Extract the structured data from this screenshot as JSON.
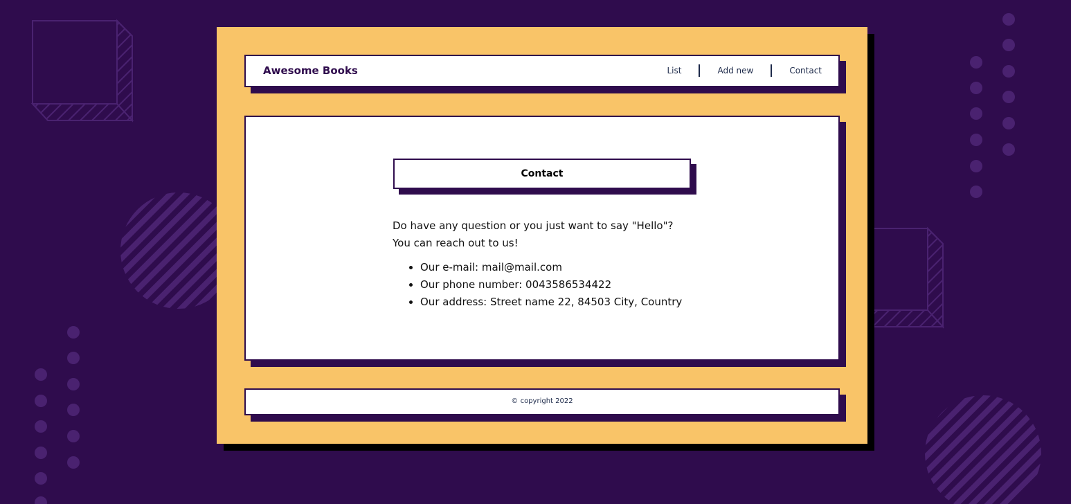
{
  "brand": "Awesome Books",
  "nav": {
    "list": "List",
    "add_new": "Add new",
    "contact": "Contact"
  },
  "main": {
    "title": "Contact",
    "intro_line1": "Do have any question or you just want to say \"Hello\"?",
    "intro_line2": "You can reach out to us!",
    "items": [
      "Our e-mail: mail@mail.com",
      "Our phone number: 0043586534422",
      "Our address: Street name 22, 84503 City, Country"
    ]
  },
  "footer": {
    "copyright": "© copyright 2022"
  },
  "colors": {
    "background": "#2f0c4d",
    "app": "#f9c468",
    "panel": "#ffffff",
    "accent": "#2f0c4d"
  }
}
